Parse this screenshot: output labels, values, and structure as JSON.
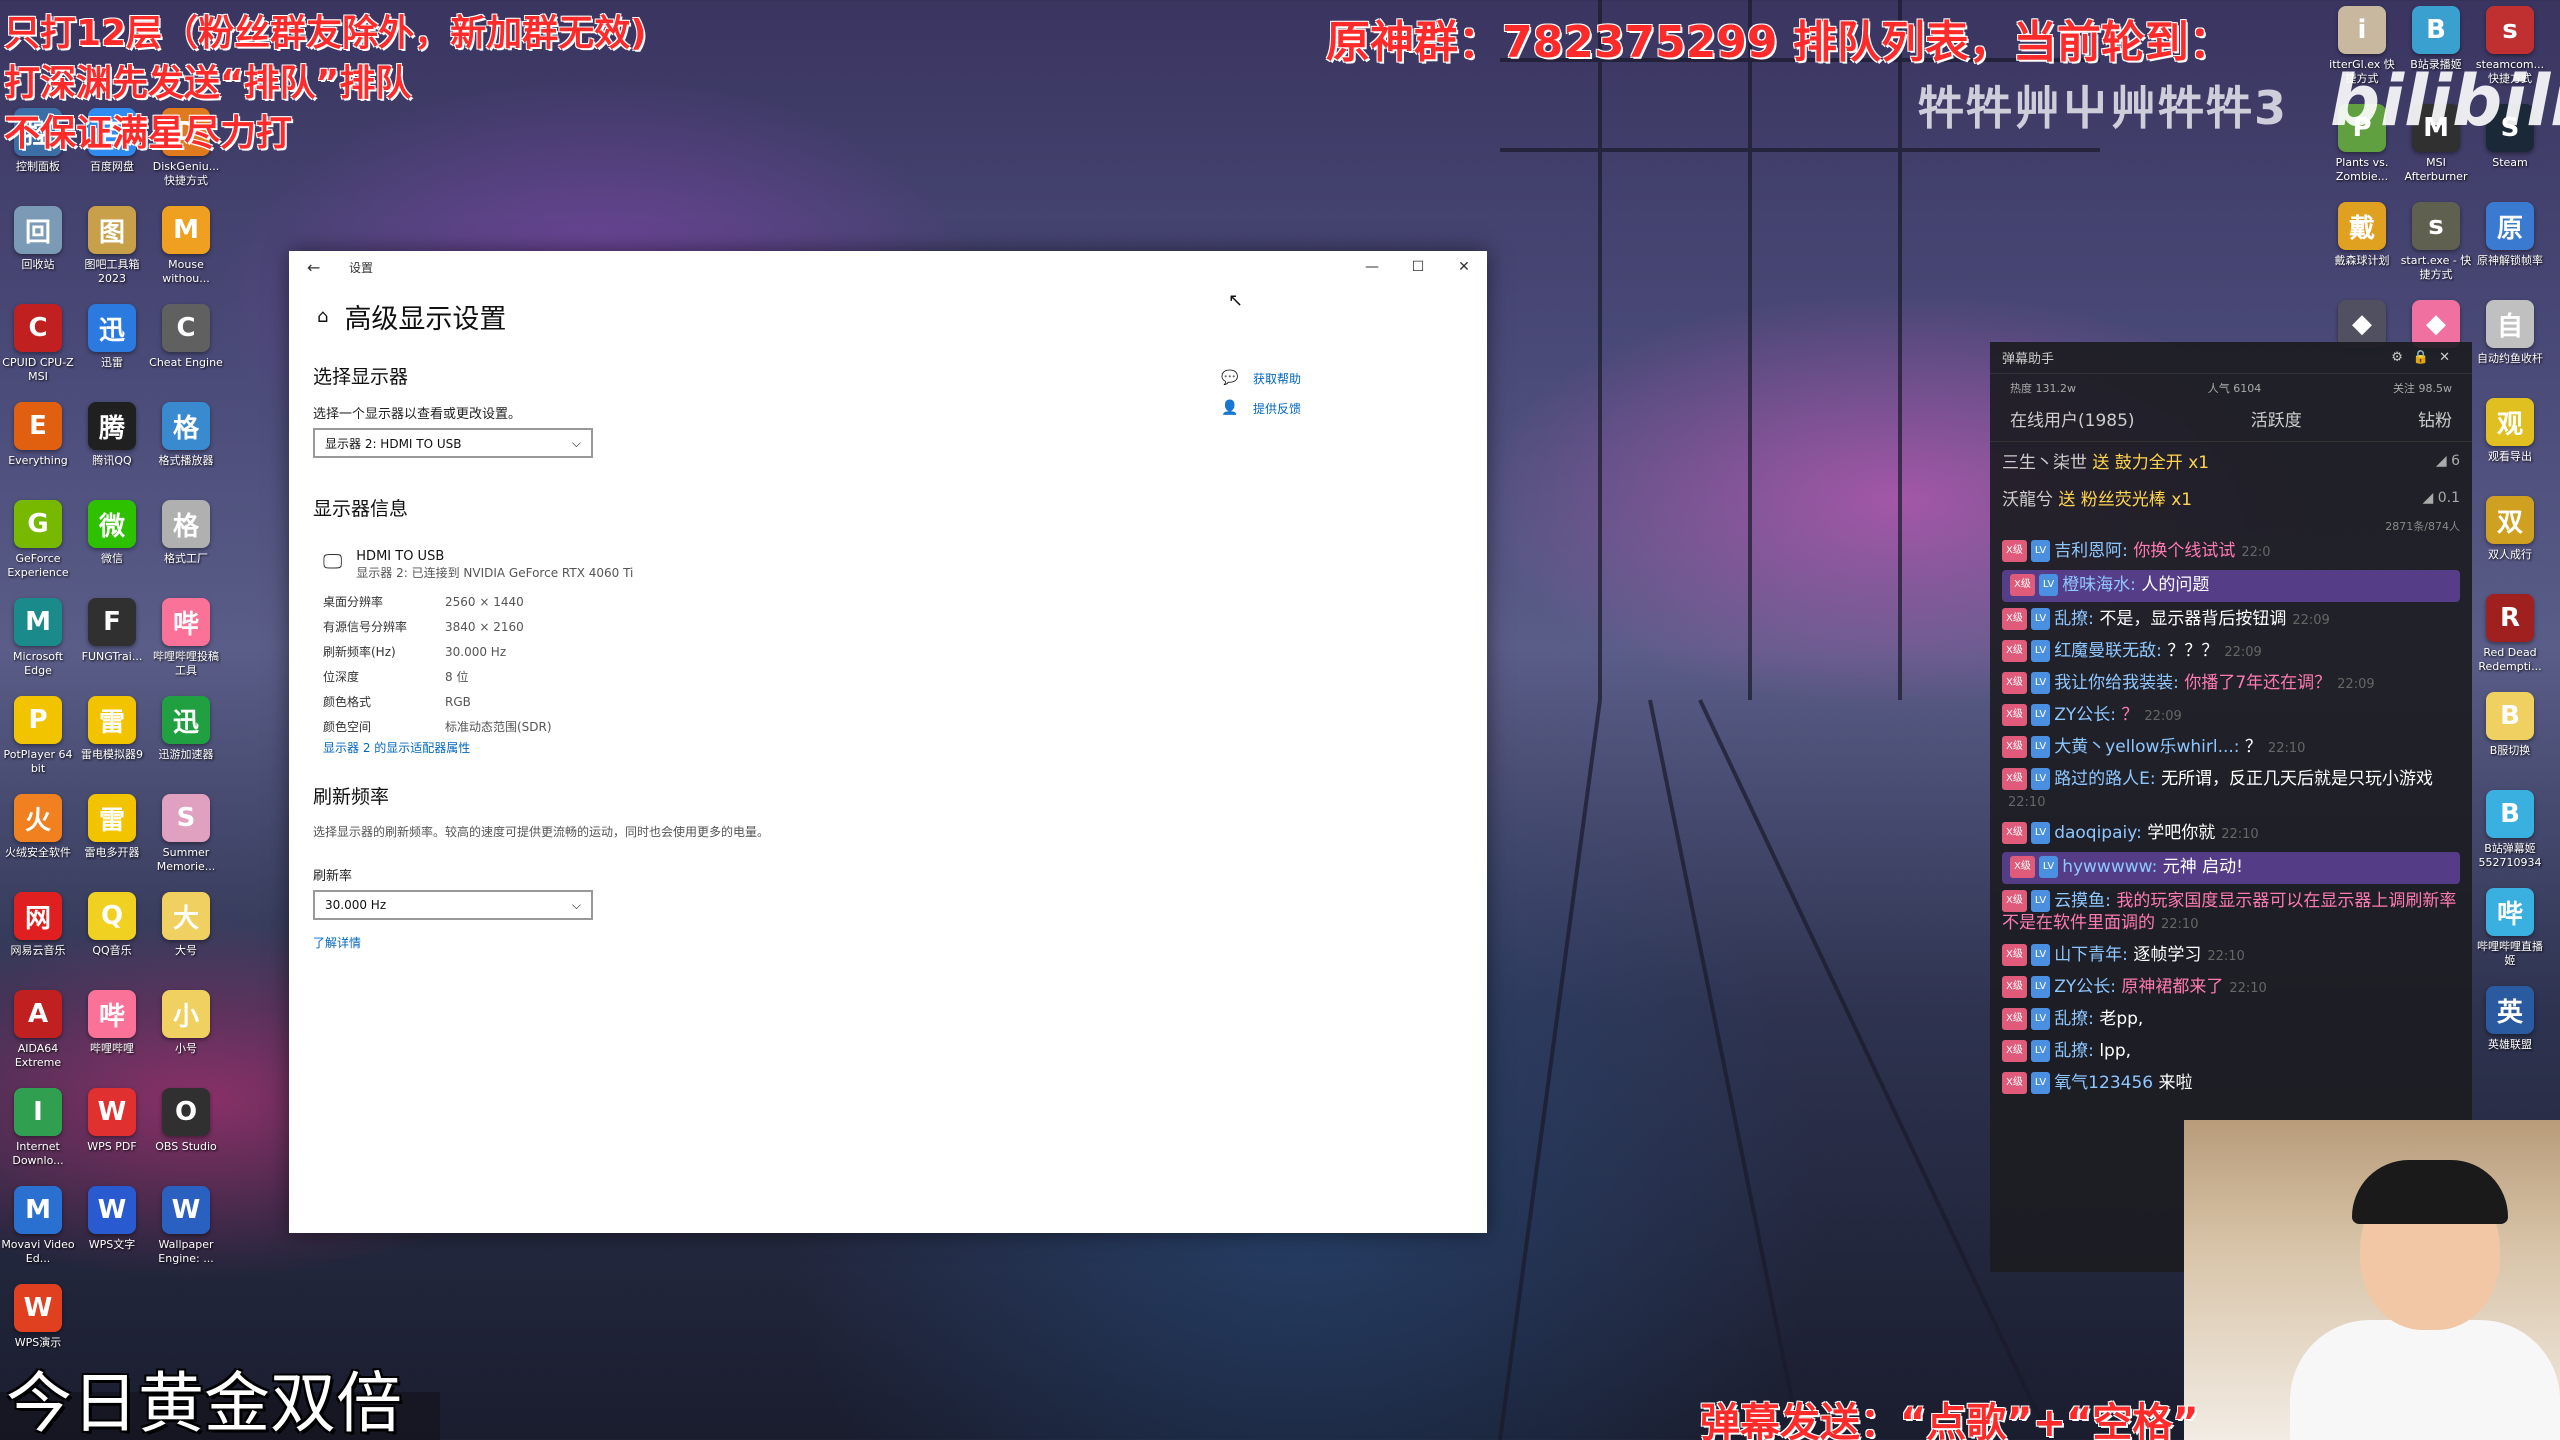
{
  "overlay": {
    "left_lines": [
      "只打12层（粉丝群友除外，新加群无效)",
      "打深渊先发送“排队”排队",
      "不保证满星尽力打"
    ],
    "top_banner": "原神群：782375299 排队列表，当前轮到：",
    "queue_sub": "牪牪艸屮艸牪牪3",
    "bilibili_logo": "bilibili",
    "bottom_left": "今日黄金双倍",
    "bottom_right": "弹幕发送：“点歌”+“空格”"
  },
  "desktop_left": [
    {
      "label": "控制面板",
      "icon": "control-panel-icon",
      "color": "#3a6ea5"
    },
    {
      "label": "百度网盘",
      "icon": "baidu-netdisk-icon",
      "color": "#2f8bf0"
    },
    {
      "label": "DiskGeniu... 快捷方式",
      "icon": "diskgenius-icon",
      "color": "#e07a1f"
    },
    {
      "label": "回收站",
      "icon": "recycle-bin-icon",
      "color": "#7a9ab5"
    },
    {
      "label": "图吧工具箱 2023",
      "icon": "toolbox-icon",
      "color": "#c8a04a"
    },
    {
      "label": "Mouse withou...",
      "icon": "mouse-icon",
      "color": "#f0a020"
    },
    {
      "label": "CPUID CPU-Z MSI",
      "icon": "cpuz-icon",
      "color": "#c02020"
    },
    {
      "label": "迅雷",
      "icon": "xunlei-icon",
      "color": "#2a7ae0"
    },
    {
      "label": "Cheat Engine",
      "icon": "cheat-engine-icon",
      "color": "#606060"
    },
    {
      "label": "Everything",
      "icon": "everything-icon",
      "color": "#e06010"
    },
    {
      "label": "腾讯QQ",
      "icon": "qq-icon",
      "color": "#202020"
    },
    {
      "label": "格式播放器",
      "icon": "player-icon",
      "color": "#3a8ad0"
    },
    {
      "label": "GeForce Experience",
      "icon": "geforce-icon",
      "color": "#76b900"
    },
    {
      "label": "微信",
      "icon": "wechat-icon",
      "color": "#2dc100"
    },
    {
      "label": "格式工厂",
      "icon": "format-factory-icon",
      "color": "#b0b0b0"
    },
    {
      "label": "Microsoft Edge",
      "icon": "edge-icon",
      "color": "#1a8a8a"
    },
    {
      "label": "FUNGTrai...",
      "icon": "game-icon",
      "color": "#303030"
    },
    {
      "label": "哔哩哔哩投稿工具",
      "icon": "bilibili-upload-icon",
      "color": "#fb7299"
    },
    {
      "label": "PotPlayer 64 bit",
      "icon": "potplayer-icon",
      "color": "#f2c400"
    },
    {
      "label": "雷电模拟器9",
      "icon": "ldplayer-icon",
      "color": "#f2c400"
    },
    {
      "label": "迅游加速器",
      "icon": "xunyou-icon",
      "color": "#20a040"
    },
    {
      "label": "火绒安全软件",
      "icon": "huorong-icon",
      "color": "#f08020"
    },
    {
      "label": "雷电多开器",
      "icon": "ld-multi-icon",
      "color": "#f2c400"
    },
    {
      "label": "Summer Memorie...",
      "icon": "summer-icon",
      "color": "#e0a0c0"
    },
    {
      "label": "网易云音乐",
      "icon": "netease-music-icon",
      "color": "#e02020"
    },
    {
      "label": "QQ音乐",
      "icon": "qq-music-icon",
      "color": "#f0d020"
    },
    {
      "label": "大号",
      "icon": "folder-icon",
      "color": "#f0d060"
    },
    {
      "label": "AIDA64 Extreme",
      "icon": "aida64-icon",
      "color": "#c02020"
    },
    {
      "label": "哔哩哔哩",
      "icon": "bilibili-icon",
      "color": "#fb7299"
    },
    {
      "label": "小号",
      "icon": "folder-icon",
      "color": "#f0d060"
    },
    {
      "label": "Internet Downlo...",
      "icon": "idm-icon",
      "color": "#30a050"
    },
    {
      "label": "WPS PDF",
      "icon": "wps-pdf-icon",
      "color": "#e03030"
    },
    {
      "label": "OBS Studio",
      "icon": "obs-icon",
      "color": "#303030"
    },
    {
      "label": "Movavi Video Ed...",
      "icon": "movavi-icon",
      "color": "#2a70d0"
    },
    {
      "label": "WPS文字",
      "icon": "wps-writer-icon",
      "color": "#2a5ad0"
    },
    {
      "label": "Wallpaper Engine: ...",
      "icon": "wallpaper-engine-icon",
      "color": "#2a60c0"
    },
    {
      "label": "WPS演示",
      "icon": "wps-ppt-icon",
      "color": "#e04020"
    }
  ],
  "desktop_right": [
    {
      "label": "itterGl.ex 快捷方式",
      "icon": "anime-icon",
      "color": "#c8b8a0"
    },
    {
      "label": "B站录播姬",
      "icon": "recorder-icon",
      "color": "#3aa0d0"
    },
    {
      "label": "steamcom... 快捷方式",
      "icon": "steamcom-icon",
      "color": "#c03030"
    },
    {
      "label": "Plants vs. Zombie...",
      "icon": "pvz-icon",
      "color": "#60a040"
    },
    {
      "label": "MSI Afterburner",
      "icon": "afterburner-icon",
      "color": "#303030"
    },
    {
      "label": "Steam",
      "icon": "steam-icon",
      "color": "#1b2838"
    },
    {
      "label": "戴森球计划",
      "icon": "dsp-icon",
      "color": "#e0a020"
    },
    {
      "label": "start.exe - 快捷方式",
      "icon": "start-icon",
      "color": "#606050"
    },
    {
      "label": "原神解锁帧率",
      "icon": "genshin-fps-icon",
      "color": "#3a7ad0"
    },
    {
      "label": "",
      "icon": "anime-icon",
      "color": "#505060"
    },
    {
      "label": "",
      "icon": "heart-icon",
      "color": "#f070a0"
    },
    {
      "label": "自动约鱼收杆",
      "icon": "fishing-icon",
      "color": "#c0c0c0"
    },
    {
      "label": "观看导出",
      "icon": "export-icon",
      "color": "#e0c020"
    },
    {
      "label": "双人成行",
      "icon": "it-takes-two-icon",
      "color": "#d0a020"
    },
    {
      "label": "Red Dead Redempti...",
      "icon": "rdr-icon",
      "color": "#a02020"
    },
    {
      "label": "B服切换",
      "icon": "folder-icon",
      "color": "#f0d060"
    },
    {
      "label": "B站弹幕姬 552710934",
      "icon": "danmaku-icon",
      "color": "#3ab0e0"
    },
    {
      "label": "哔哩哔哩直播姬",
      "icon": "live-icon",
      "color": "#3ab0e0"
    },
    {
      "label": "英雄联盟",
      "icon": "lol-icon",
      "color": "#2a5aa0"
    }
  ],
  "settings": {
    "window_title": "设置",
    "page_title": "高级显示设置",
    "select_display_heading": "选择显示器",
    "select_display_desc": "选择一个显示器以查看或更改设置。",
    "display_dropdown": "显示器 2: HDMI TO USB",
    "display_info_heading": "显示器信息",
    "monitor_name": "HDMI TO USB",
    "monitor_sub": "显示器 2: 已连接到 NVIDIA GeForce RTX 4060 Ti",
    "props": [
      {
        "k": "桌面分辨率",
        "v": "2560 × 1440"
      },
      {
        "k": "有源信号分辨率",
        "v": "3840 × 2160"
      },
      {
        "k": "刷新频率(Hz)",
        "v": "30.000 Hz"
      },
      {
        "k": "位深度",
        "v": "8 位"
      },
      {
        "k": "颜色格式",
        "v": "RGB"
      },
      {
        "k": "颜色空间",
        "v": "标准动态范围(SDR)"
      }
    ],
    "adapter_link": "显示器 2 的显示适配器属性",
    "refresh_heading": "刷新频率",
    "refresh_desc": "选择显示器的刷新频率。较高的速度可提供更流畅的运动，同时也会使用更多的电量。",
    "refresh_label": "刷新率",
    "refresh_dropdown": "30.000 Hz",
    "learn_more": "了解详情",
    "help_link": "获取帮助",
    "feedback_link": "提供反馈"
  },
  "chat": {
    "title": "弹幕助手",
    "stats": [
      "热度 131.2w",
      "人气 6104",
      "关注 98.5w"
    ],
    "tabs": [
      "在线用户(1985)",
      "活跃度",
      "钻粉"
    ],
    "gifts": [
      {
        "user": "三生丶柒世",
        "gift": "送 鼓力全开",
        "count": "x1",
        "cost": "6"
      },
      {
        "user": "沃龍兮",
        "gift": "送 粉丝荧光棒",
        "count": "x1",
        "cost": "0.1"
      }
    ],
    "capacity": "2871条/874人",
    "messages": [
      {
        "user": "吉利恩阿:",
        "text": "你换个线试试",
        "time": "22:0",
        "pink": true,
        "hl": false
      },
      {
        "user": "橙味海水:",
        "text": "人的问题",
        "time": "",
        "pink": false,
        "hl": true
      },
      {
        "user": "乱撩:",
        "text": "不是，显示器背后按钮调",
        "time": "22:09",
        "pink": false,
        "hl": false
      },
      {
        "user": "红魔曼联无敌:",
        "text": "？？？",
        "time": "22:09",
        "pink": false,
        "hl": false
      },
      {
        "user": "我让你给我装装:",
        "text": "你播了7年还在调？",
        "time": "22:09",
        "pink": true,
        "hl": false
      },
      {
        "user": "ZY公长:",
        "text": "？",
        "time": "22:09",
        "pink": true,
        "hl": false
      },
      {
        "user": "大黄丶yellow乐whirl...:",
        "text": "？",
        "time": "22:10",
        "pink": false,
        "hl": false
      },
      {
        "user": "路过的路人E:",
        "text": "无所谓，反正几天后就是只玩小游戏",
        "time": "22:10",
        "pink": false,
        "hl": false
      },
      {
        "user": "daoqipaiy:",
        "text": "学吧你就",
        "time": "22:10",
        "pink": false,
        "hl": false
      },
      {
        "user": "hywwwww:",
        "text": "元神 启动!",
        "time": "",
        "pink": false,
        "hl": true
      },
      {
        "user": "云摸鱼:",
        "text": "我的玩家国度显示器可以在显示器上调刷新率 不是在软件里面调的",
        "time": "22:10",
        "pink": true,
        "hl": false
      },
      {
        "user": "山下青年:",
        "text": "逐帧学习",
        "time": "22:10",
        "pink": false,
        "hl": false
      },
      {
        "user": "ZY公长:",
        "text": "原神裙都来了",
        "time": "22:10",
        "pink": true,
        "hl": false
      },
      {
        "user": "乱撩:",
        "text": "老pp,",
        "time": "",
        "pink": false,
        "hl": false
      },
      {
        "user": "乱撩:",
        "text": "lpp,",
        "time": "",
        "pink": false,
        "hl": false
      },
      {
        "user": "氧气123456",
        "text": "来啦",
        "time": "",
        "pink": false,
        "hl": false
      }
    ],
    "badge_label": "X级",
    "level_label": "LV"
  }
}
